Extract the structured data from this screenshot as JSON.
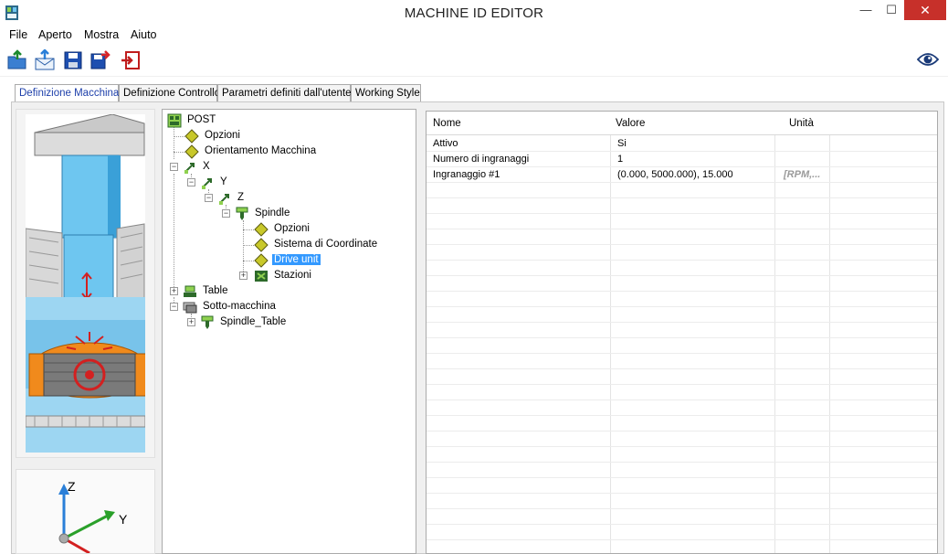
{
  "window": {
    "title": "MACHINE ID EDITOR",
    "minimize": "—",
    "maximize": "☐",
    "close": "✕"
  },
  "menu": [
    "File",
    "Aperto",
    "Mostra",
    "Aiuto"
  ],
  "tabs": [
    {
      "label": "Definizione Macchina",
      "active": true
    },
    {
      "label": "Definizione Controllo",
      "active": false
    },
    {
      "label": "Parametri definiti dall'utente",
      "active": false
    },
    {
      "label": "Working Style",
      "active": false
    }
  ],
  "axes": {
    "z": "Z",
    "y": "Y"
  },
  "tree": [
    {
      "label": "POST",
      "icon": "post-icon"
    },
    {
      "label": "Opzioni",
      "icon": "diamond-icon"
    },
    {
      "label": "Orientamento Macchina",
      "icon": "diamond-icon"
    },
    {
      "label": "X",
      "icon": "axis-icon"
    },
    {
      "label": "Y",
      "icon": "axis-icon"
    },
    {
      "label": "Z",
      "icon": "axis-icon"
    },
    {
      "label": "Spindle",
      "icon": "spindle-icon"
    },
    {
      "label": "Opzioni",
      "icon": "diamond-icon"
    },
    {
      "label": "Sistema di Coordinate",
      "icon": "diamond-icon"
    },
    {
      "label": "Drive unit",
      "icon": "diamond-icon",
      "selected": true
    },
    {
      "label": "Stazioni",
      "icon": "stations-icon"
    },
    {
      "label": "Table",
      "icon": "table-icon"
    },
    {
      "label": "Sotto-macchina",
      "icon": "submachine-icon"
    },
    {
      "label": "Spindle_Table",
      "icon": "spindle-icon"
    }
  ],
  "grid": {
    "headers": [
      "Nome",
      "Valore",
      "Unità"
    ],
    "rows": [
      {
        "name": "Attivo",
        "value": "Si",
        "unit": ""
      },
      {
        "name": "Numero di ingranaggi",
        "value": "1",
        "unit": ""
      },
      {
        "name": "Ingranaggio #1",
        "value": "(0.000, 5000.000), 15.000",
        "unit": "[RPM,..."
      }
    ]
  },
  "colors": {
    "selection": "#3399ff",
    "close_button": "#c7302a",
    "active_tab_text": "#1d3faa",
    "machine_blue": "#6ec6f0",
    "machine_orange": "#f08a1c"
  }
}
